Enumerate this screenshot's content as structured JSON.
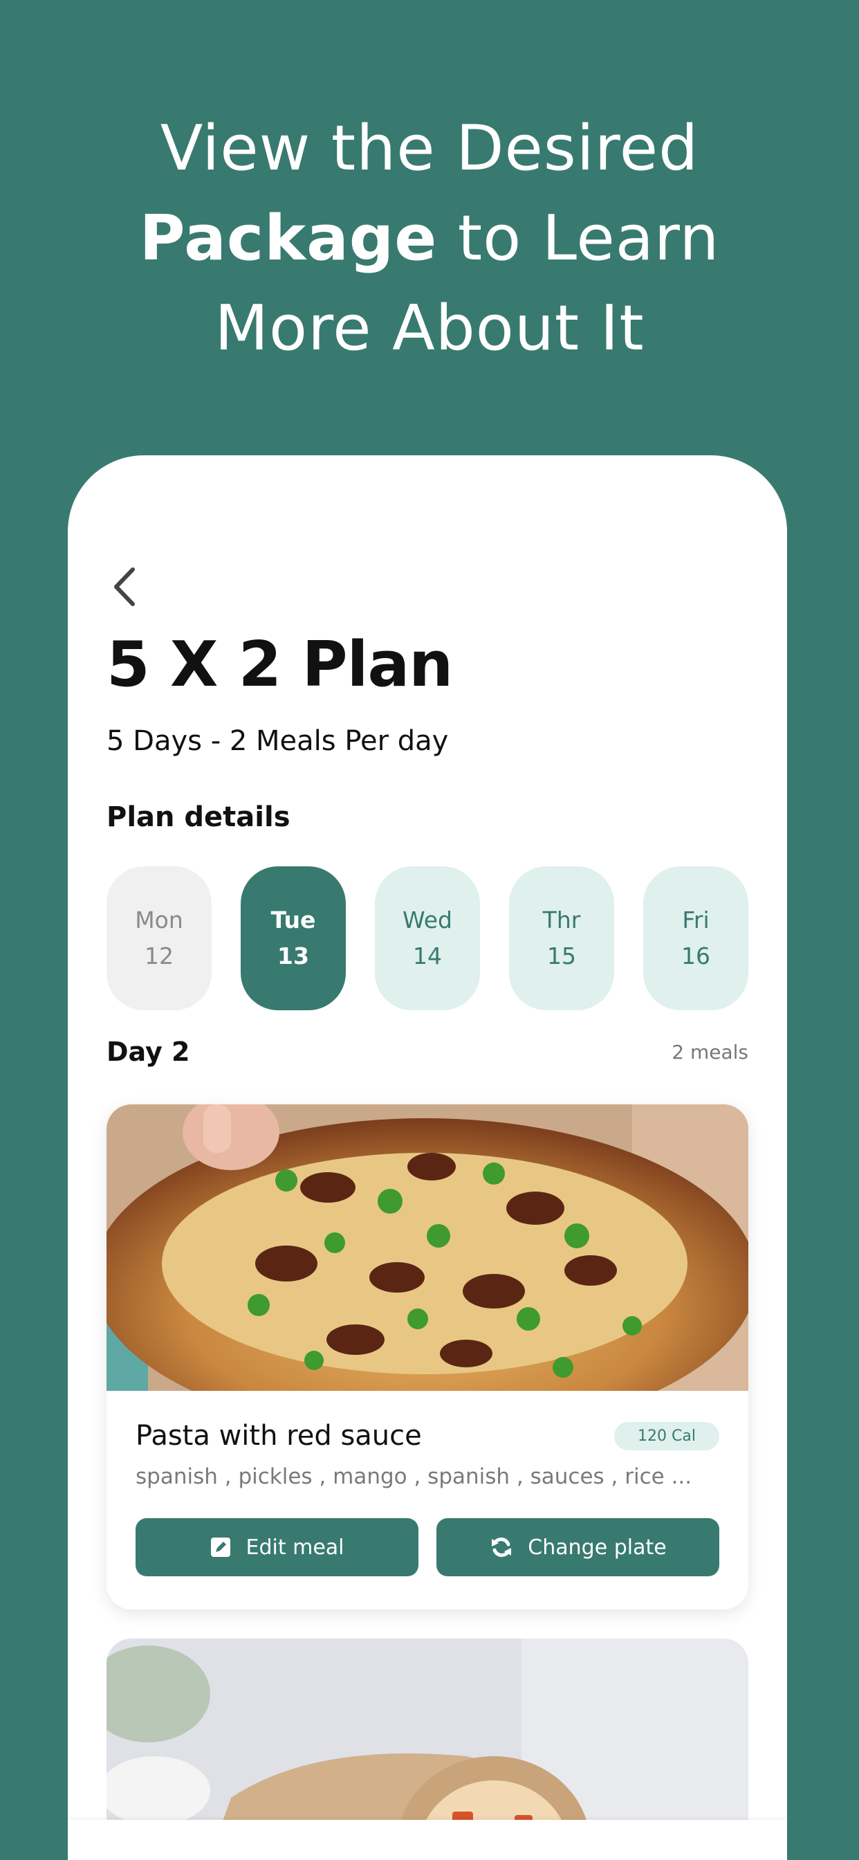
{
  "headline": {
    "line1": "View the Desired",
    "line2_bold": "Package",
    "line2_rest": " to Learn",
    "line3": "More About It"
  },
  "plan": {
    "title": "5 X 2 Plan",
    "subtitle": "5 Days - 2 Meals Per day",
    "details_label": "Plan details"
  },
  "days": [
    {
      "name": "Mon",
      "num": "12",
      "state": "past"
    },
    {
      "name": "Tue",
      "num": "13",
      "state": "active"
    },
    {
      "name": "Wed",
      "num": "14",
      "state": "upcoming"
    },
    {
      "name": "Thr",
      "num": "15",
      "state": "upcoming"
    },
    {
      "name": "Fri",
      "num": "16",
      "state": "upcoming"
    }
  ],
  "day_section": {
    "label": "Day 2",
    "count": "2 meals"
  },
  "meal": {
    "name": "Pasta with red sauce",
    "calories": "120 Cal",
    "ingredients": "spanish , pickles  , mango  , spanish , sauces , rice ...",
    "edit_label": "Edit meal",
    "change_label": "Change plate"
  },
  "icons": {
    "back": "chevron-left-icon",
    "edit": "edit-icon",
    "change": "refresh-icon"
  },
  "colors": {
    "brand": "#387a6f",
    "brand_light": "#dff0ed",
    "past_day_bg": "#f0f0f0"
  }
}
